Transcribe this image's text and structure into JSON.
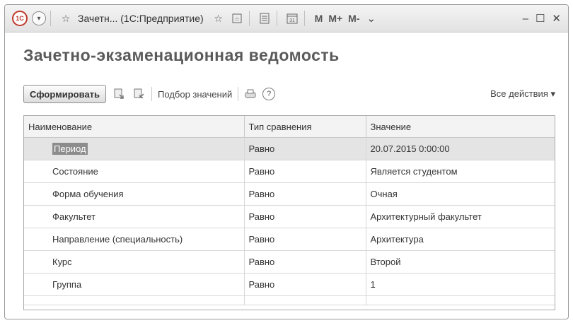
{
  "titlebar": {
    "logo": "1С",
    "title": "Зачетн...  (1С:Предприятие)",
    "calc": [
      "M",
      "M+",
      "M-"
    ]
  },
  "page": {
    "title": "Зачетно-экзаменационная ведомость"
  },
  "toolbar": {
    "generate_label": "Сформировать",
    "pick_values_label": "Подбор значений",
    "help_label": "?",
    "all_actions_label": "Все действия ▾"
  },
  "table": {
    "columns": [
      "Наименование",
      "Тип сравнения",
      "Значение"
    ],
    "rows": [
      {
        "name": "Период",
        "comparison": "Равно",
        "value": "20.07.2015 0:00:00"
      },
      {
        "name": "Состояние",
        "comparison": "Равно",
        "value": "Является студентом"
      },
      {
        "name": "Форма обучения",
        "comparison": "Равно",
        "value": "Очная"
      },
      {
        "name": "Факультет",
        "comparison": "Равно",
        "value": "Архитектурный факультет"
      },
      {
        "name": "Направление (специальность)",
        "comparison": "Равно",
        "value": "Архитектура"
      },
      {
        "name": "Курс",
        "comparison": "Равно",
        "value": "Второй"
      },
      {
        "name": "Группа",
        "comparison": "Равно",
        "value": "1"
      }
    ]
  }
}
